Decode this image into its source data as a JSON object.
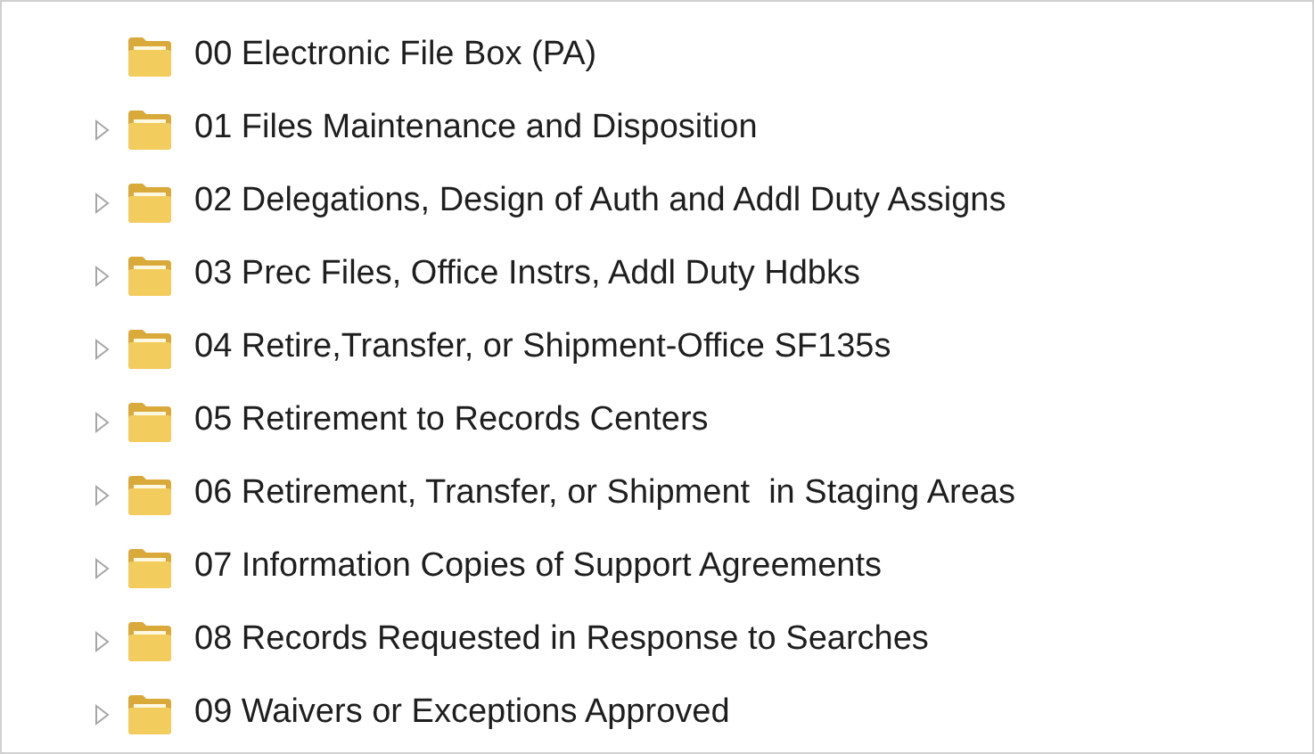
{
  "tree": {
    "items": [
      {
        "label": "00 Electronic File Box (PA)"
      },
      {
        "label": "01 Files Maintenance and Disposition",
        "expanded": false
      },
      {
        "label": "02 Delegations, Design of Auth and Addl Duty Assigns",
        "expanded": false
      },
      {
        "label": "03 Prec Files, Office Instrs, Addl Duty Hdbks",
        "expanded": false
      },
      {
        "label": "04 Retire,Transfer, or Shipment-Office SF135s",
        "expanded": false
      },
      {
        "label": "05 Retirement to Records Centers",
        "expanded": false
      },
      {
        "label": "06 Retirement, Transfer, or Shipment  in Staging Areas",
        "expanded": false
      },
      {
        "label": "07 Information Copies of Support Agreements",
        "expanded": false
      },
      {
        "label": "08 Records Requested in Response to Searches",
        "expanded": false
      },
      {
        "label": "09 Waivers or Exceptions Approved",
        "expanded": false
      }
    ]
  }
}
